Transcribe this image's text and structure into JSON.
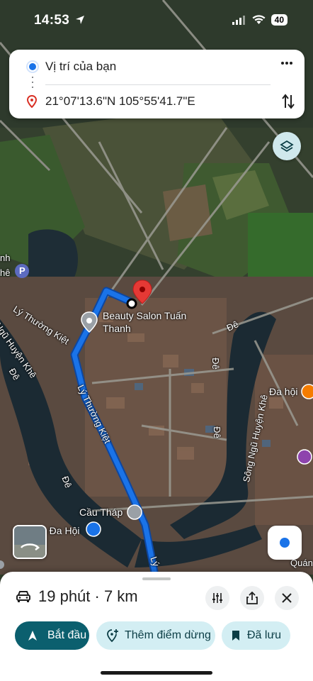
{
  "status_bar": {
    "time": "14:53",
    "battery": "40"
  },
  "route_card": {
    "origin": "Vị trí của bạn",
    "destination": "21°07'13.6\"N 105°55'41.7\"E"
  },
  "map": {
    "place_beauty_line1": "Beauty Salon Tuấn",
    "place_beauty_line2": "Thanh",
    "place_cau_thap": "Cầu Tháp",
    "place_da_hoi_left": "n Đa Hội",
    "place_da_hoi_right": "Đa hội",
    "place_quan": "Quán",
    "street_ly_thuong_kiet_top": "Lý Thường Kiệt",
    "street_ly_thuong_kiet_route": "Lý Thường Kiệt",
    "street_ly_thuong_kiet_bottom": "Lý",
    "street_ngu_huyen_khe_left": "Ngũ Huyện Khê",
    "street_song_ngu_huyen_khe": "Sông Ngũ Huyện Khê",
    "street_de_1": "Đê",
    "street_de_2": "Đê",
    "street_de_3": "Đê",
    "street_de_4": "Đê",
    "street_de_5": "Đê",
    "street_nh": "nh",
    "street_he": "hê",
    "parking": "P"
  },
  "bottom_sheet": {
    "duration_distance": "19 phút · 7 km",
    "start_label": "Bắt đầu",
    "add_stop_label": "Thêm điểm dừng",
    "saved_label": "Đã lưu"
  },
  "colors": {
    "route": "#1a73e8",
    "primary_chip": "#0b5f6e",
    "secondary_chip": "#d3eef3",
    "destination_pin": "#e53935"
  }
}
